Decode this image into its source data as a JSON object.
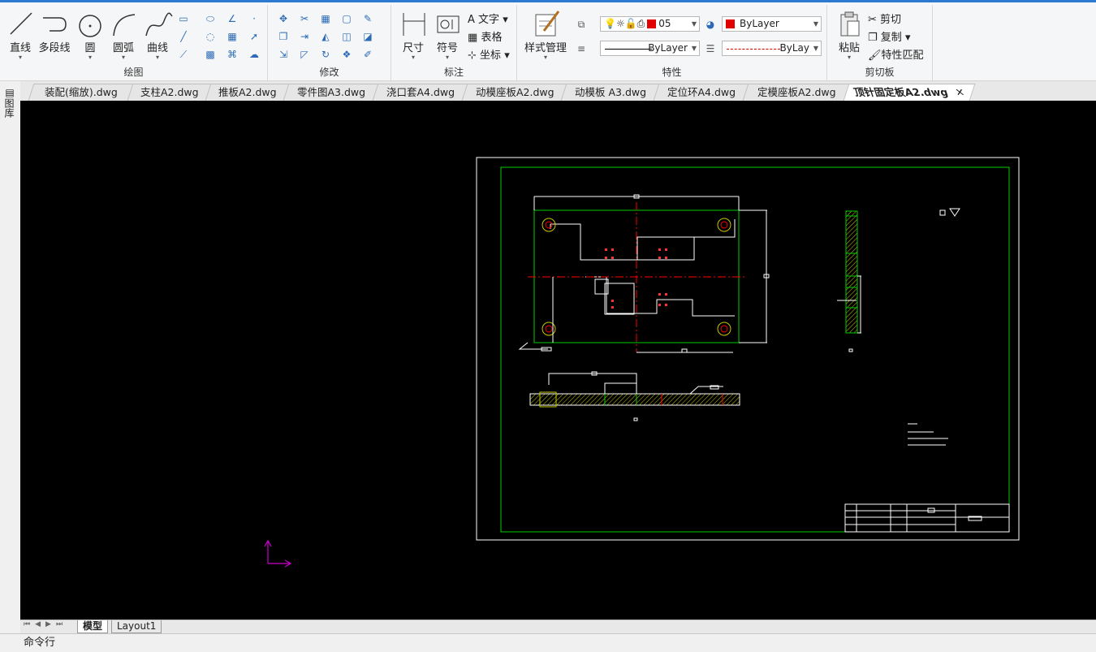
{
  "ribbon": {
    "draw_panel": {
      "label": "绘图",
      "line": "直线",
      "polyline": "多段线",
      "circle": "圆",
      "arc": "圆弧",
      "curve": "曲线"
    },
    "modify_panel": {
      "label": "修改"
    },
    "annotate_panel": {
      "label": "标注",
      "dimension": "尺寸",
      "symbol": "符号",
      "text": "文字",
      "table": "表格",
      "coordinate": "坐标"
    },
    "properties_panel": {
      "label": "特性",
      "style_manager": "样式管理",
      "layer_value": "05",
      "color_value": "ByLayer",
      "linetype_value": "ByLayer",
      "lineweight_value": "ByLay"
    },
    "clipboard_panel": {
      "label": "剪切板",
      "paste": "粘贴",
      "cut": "剪切",
      "copy": "复制",
      "match": "特性匹配"
    }
  },
  "side": {
    "label": "图库"
  },
  "tabs": [
    {
      "label": "装配(缩放).dwg"
    },
    {
      "label": "支柱A2.dwg"
    },
    {
      "label": "推板A2.dwg"
    },
    {
      "label": "零件图A3.dwg"
    },
    {
      "label": "浇口套A4.dwg"
    },
    {
      "label": "动模座板A2.dwg"
    },
    {
      "label": "动模板 A3.dwg"
    },
    {
      "label": "定位环A4.dwg"
    },
    {
      "label": "定模座板A2.dwg"
    },
    {
      "label": "顶针固定板A2.dwg"
    }
  ],
  "layout_tabs": {
    "model": "模型",
    "layout1": "Layout1"
  },
  "command": {
    "label": "命令行"
  },
  "colors": {
    "accent": "#2b79d0",
    "canvas": "#000000",
    "frame_green": "#00cc00",
    "center_red": "#ff0000",
    "ucs_magenta": "#cc00cc"
  }
}
